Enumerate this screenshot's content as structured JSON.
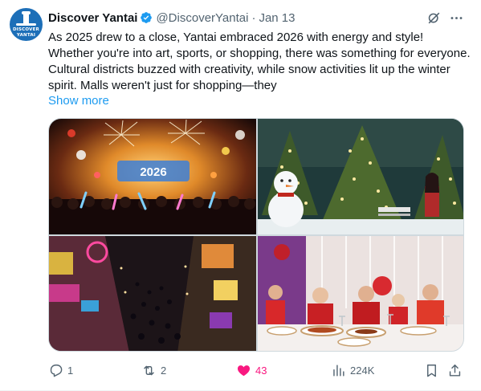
{
  "author": {
    "display_name": "Discover Yantai",
    "handle": "@DiscoverYantai",
    "separator": "·",
    "date": "Jan 13",
    "avatar_text": [
      "DISCOVER",
      "YANTAI"
    ],
    "verified": true
  },
  "tweet": {
    "text": "As 2025 drew to a close, Yantai embraced 2026 with energy and style! Whether you're into art, sports, or shopping, there was something for everyone. Cultural districts buzzed with creativity, while snow activities lit up the winter spirit. Malls weren't just for shopping—they",
    "show_more": "Show more"
  },
  "media": {
    "photos": [
      {
        "name": "concert-photo",
        "caption": "2026"
      },
      {
        "name": "snowman-christmas-photo"
      },
      {
        "name": "night-street-photo"
      },
      {
        "name": "family-dinner-photo"
      }
    ]
  },
  "actions": {
    "reply_count": "1",
    "retweet_count": "2",
    "like_count": "43",
    "views_count": "224K",
    "liked": true
  },
  "colors": {
    "accent": "#1d9bf0",
    "like": "#f91880",
    "muted": "#536471",
    "text": "#0f1419",
    "avatar_bg": "#1d6fb8",
    "verified": "#1d9bf0"
  },
  "icons": [
    "grok-icon",
    "more-icon",
    "reply-icon",
    "retweet-icon",
    "heart-icon",
    "views-icon",
    "bookmark-icon",
    "share-icon",
    "verified-badge-icon"
  ]
}
